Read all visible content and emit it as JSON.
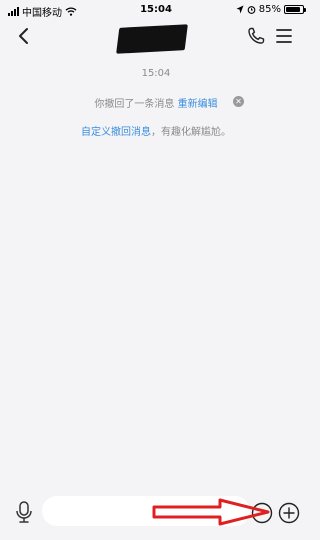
{
  "status_bar": {
    "carrier": "中国移动",
    "time": "15:04",
    "battery_percent": "85%",
    "battery_level": 0.85,
    "icons": [
      "signal-icon",
      "wifi-icon",
      "location-icon",
      "alarm-icon",
      "battery-icon"
    ]
  },
  "nav": {
    "icons": [
      "back-arrow-icon",
      "phone-icon",
      "menu-icon"
    ]
  },
  "chat": {
    "timestamp": "15:04",
    "recall_text": "你撤回了一条消息",
    "re_edit_link": "重新编辑",
    "custom_link": "自定义撤回消息",
    "custom_suffix": "，有趣化解尴尬。"
  },
  "input_bar": {
    "value": "",
    "icons": [
      "microphone-icon",
      "emoji-icon",
      "plus-icon"
    ]
  },
  "colors": {
    "background": "#f4f4f7",
    "link": "#3a8dde",
    "gray_text": "#8a8a8a",
    "annotation_arrow": "#e02020"
  }
}
